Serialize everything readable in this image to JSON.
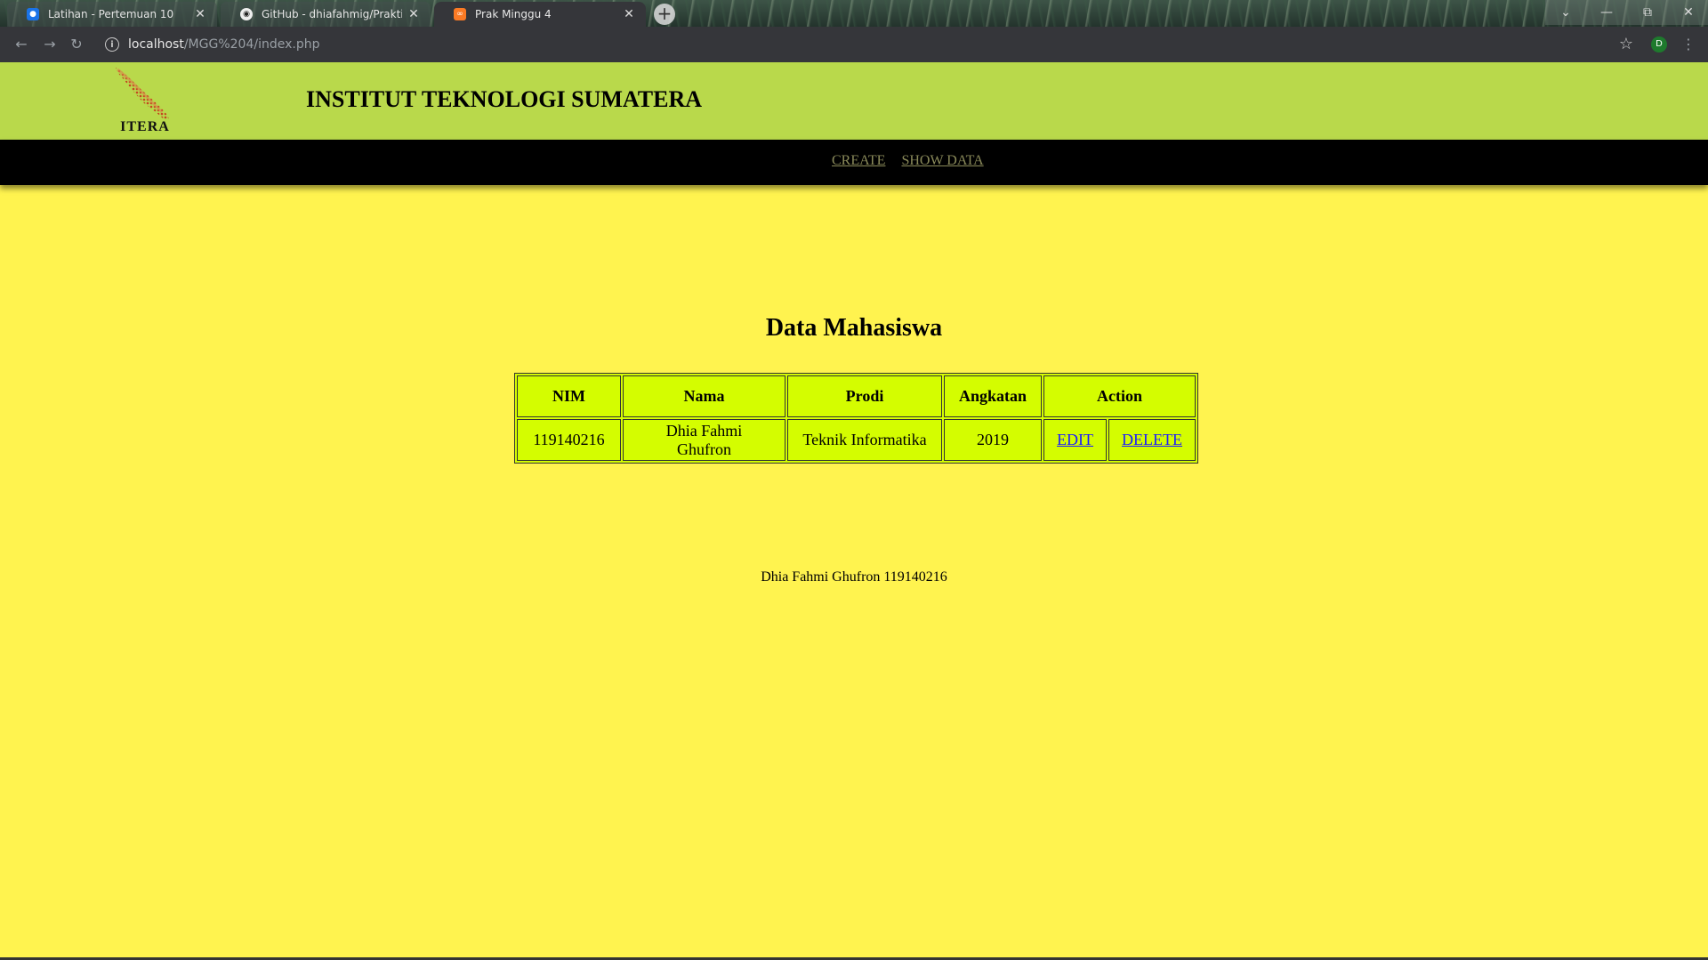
{
  "browser": {
    "tabs": [
      {
        "label": "Latihan - Pertemuan 10",
        "favicon": "classroom-icon",
        "active": false
      },
      {
        "label": "GitHub - dhiafahmig/Praktikum-",
        "favicon": "github-icon",
        "active": false
      },
      {
        "label": "Prak Minggu 4",
        "favicon": "xampp-icon",
        "active": true
      }
    ],
    "address": {
      "host": "localhost",
      "path": "/MGG%204/index.php"
    },
    "profile_initial": "D"
  },
  "header": {
    "logo_text": "ITERA",
    "title": "INSTITUT TEKNOLOGI SUMATERA"
  },
  "nav": {
    "create": "CREATE",
    "show_data": "SHOW DATA"
  },
  "main": {
    "heading": "Data Mahasiswa",
    "table": {
      "headers": [
        "NIM",
        "Nama",
        "Prodi",
        "Angkatan",
        "Action"
      ],
      "rows": [
        {
          "nim": "119140216",
          "nama": "Dhia Fahmi Ghufron",
          "prodi": "Teknik Informatika",
          "angkatan": "2019",
          "edit": "EDIT",
          "delete": "DELETE"
        }
      ]
    }
  },
  "footer": {
    "text": "Dhia Fahmi Ghufron 119140216"
  },
  "colors": {
    "page_background": "#fff34f",
    "header_background": "#b9d94b",
    "nav_background": "#000000",
    "table_background": "#d4fd00",
    "link_color": "#1a1aff"
  }
}
